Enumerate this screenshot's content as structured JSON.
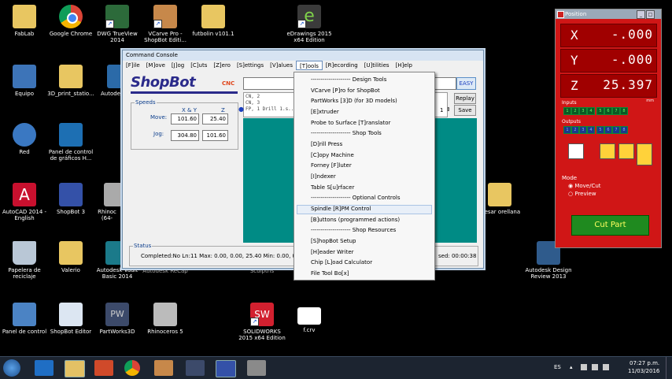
{
  "desktop_icons": [
    {
      "label": "FabLab"
    },
    {
      "label": "Google Chrome"
    },
    {
      "label": "DWG TrueView 2014"
    },
    {
      "label": "VCarve Pro - ShopBot Editi..."
    },
    {
      "label": "futbolin v101.1"
    },
    {
      "label": "eDrawings 2015 x64 Edition"
    },
    {
      "label": "Equipo"
    },
    {
      "label": "3D_print_statio..."
    },
    {
      "label": "Autode"
    },
    {
      "label": "Red"
    },
    {
      "label": "Panel de control de gráficos H..."
    },
    {
      "label": "AutoCAD 2014 - English"
    },
    {
      "label": "ShopBot 3"
    },
    {
      "label": "Rhinoc (64-"
    },
    {
      "label": "resar orellana"
    },
    {
      "label": "Papelera de reciclaje"
    },
    {
      "label": "Valerio"
    },
    {
      "label": "Autodesk Vault Basic 2014"
    },
    {
      "label": "Autodesk ReCap"
    },
    {
      "label": "Sculptris"
    },
    {
      "label": "Autodesk Design Review 2013"
    },
    {
      "label": "Panel de control"
    },
    {
      "label": "ShopBot Editor"
    },
    {
      "label": "PartWorks3D"
    },
    {
      "label": "Rhinoceros 5"
    },
    {
      "label": "SOLIDWORKS 2015 x64 Edition"
    },
    {
      "label": "f.crv"
    }
  ],
  "console": {
    "title": "Command Console",
    "menu": [
      "[F]ile",
      "[M]ove",
      "[J]og",
      "[C]uts",
      "[Z]ero",
      "[S]ettings",
      "[V]alues",
      "[T]ools",
      "[R]ecording",
      "[U]tilities",
      "[H]elp"
    ],
    "logo_text": "ShopBot",
    "logo_suffix": "CNC",
    "speeds_title": "Speeds",
    "col_xy": "X & Y",
    "col_z": "Z",
    "move_label": "Move:",
    "jog_label": "Jog:",
    "move_xy": "101.60",
    "move_z": "25.40",
    "jog_xy": "304.80",
    "jog_z": "101.60",
    "easy_label": "EASY",
    "history": [
      "CN, 2",
      "CN, 3",
      "FP, 1 Drill 1.s..."
    ],
    "history_page": "1",
    "replay_label": "Replay",
    "save_label": "Save",
    "status_title": "Status",
    "status_text": "Completed:No  Ln:11  Max: 0.00, 0.00, 25.40  Min: 0.00, 0.00,",
    "status_time": "sed: 00:00:38"
  },
  "tools_menu": [
    "-------------------- Design Tools",
    "VCarve [P]ro for ShopBot",
    "PartWorks [3]D (for 3D models)",
    "[E]xtruder",
    "Probe to Surface [T]ranslator",
    "-------------------- Shop Tools",
    "[D]rill Press",
    "[C]opy Machine",
    "Forney [F]luter",
    "[I]ndexer",
    "Table S[u]rfacer",
    "-------------------- Optional Controls",
    "Spindle [R]PM Control",
    "[B]uttons (programmed actions)",
    "-------------------- Shop Resources",
    "[S]hopBot Setup",
    "[H]eader Writer",
    "Chip [L]oad Calculator",
    "File Tool Bo[x]"
  ],
  "tools_menu_highlight": "Spindle [R]PM Control",
  "position": {
    "title": "Position",
    "axes": [
      {
        "name": "X",
        "value": "-.000",
        "unit": "mm"
      },
      {
        "name": "Y",
        "value": "-.000",
        "unit": "mm"
      },
      {
        "name": "Z",
        "value": "25.397",
        "unit": "mm"
      }
    ],
    "inputs_label": "Inputs",
    "outputs_label": "Outputs",
    "input_leds": [
      "1",
      "2",
      "3",
      "4",
      "5",
      "6",
      "7",
      "8"
    ],
    "output_leds": [
      "1",
      "2",
      "3",
      "4",
      "5",
      "6",
      "7",
      "8"
    ],
    "mode_label": "Mode",
    "mode_move": "Move/Cut",
    "mode_preview": "Preview",
    "cut_part": "Cut Part"
  },
  "taskbar": {
    "language": "ES",
    "time": "07:27 p.m.",
    "date": "11/03/2016"
  }
}
